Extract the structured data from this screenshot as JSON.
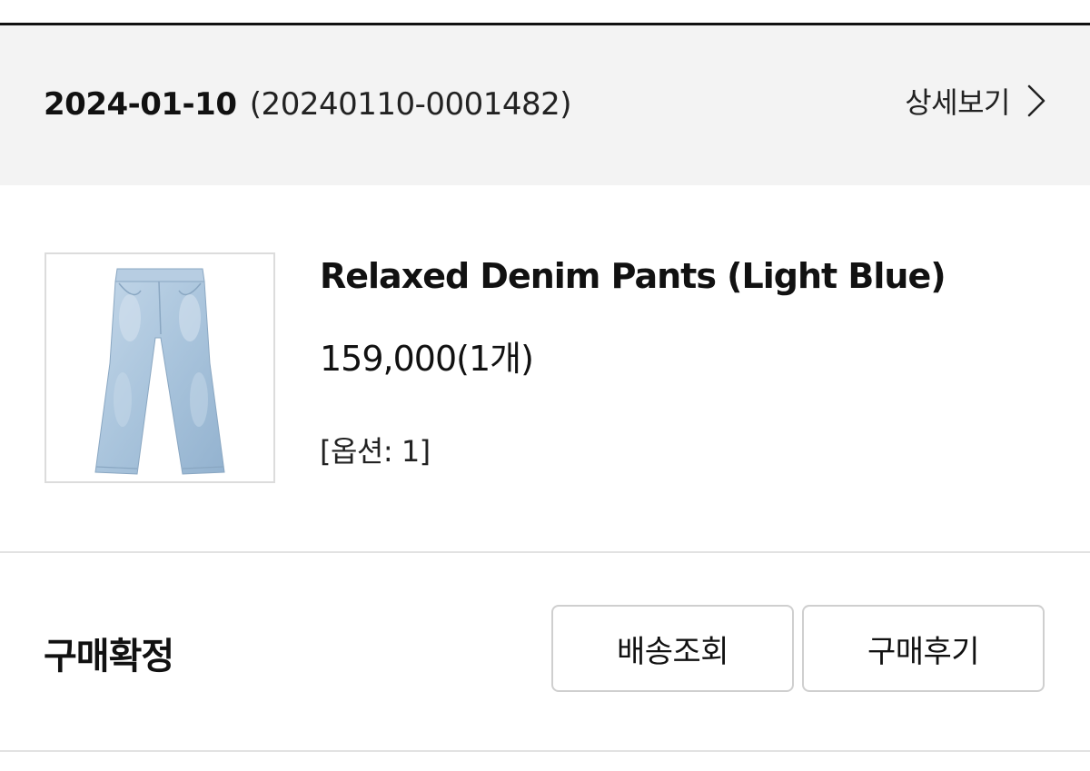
{
  "order": {
    "date": "2024-01-10",
    "number": "(20240110-0001482)",
    "detail_label": "상세보기",
    "detail_icon": "chevron-right-icon"
  },
  "product": {
    "name": "Relaxed Denim Pants (Light Blue)",
    "price": "159,000(1개)",
    "option": "[옵션: 1]",
    "image_alt": "light blue denim pants"
  },
  "status": {
    "label": "구매확정"
  },
  "actions": {
    "track_label": "배송조회",
    "review_label": "구매후기"
  },
  "colors": {
    "header_bg": "#f3f3f3",
    "denim": "#a9c4dc",
    "border": "#cfcfcf"
  }
}
